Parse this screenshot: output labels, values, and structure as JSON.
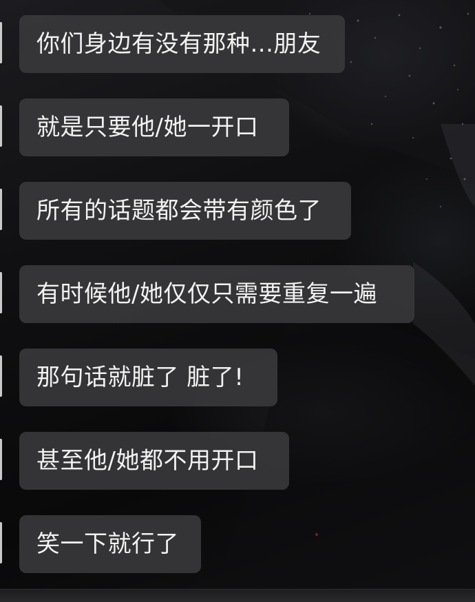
{
  "messages": [
    {
      "text": "你们身边有没有那种...朋友"
    },
    {
      "text": "就是只要他/她一开口"
    },
    {
      "text": "所有的话题都会带有颜色了"
    },
    {
      "text": "有时候他/她仅仅只需要重复一遍"
    },
    {
      "text": "那句话就脏了 脏了!"
    },
    {
      "text": "甚至他/她都不用开口"
    },
    {
      "text": "笑一下就行了"
    }
  ],
  "colors": {
    "bubble_background": "#38383a",
    "bubble_text": "#f2f2f2",
    "page_background": "#0b0b0d"
  }
}
